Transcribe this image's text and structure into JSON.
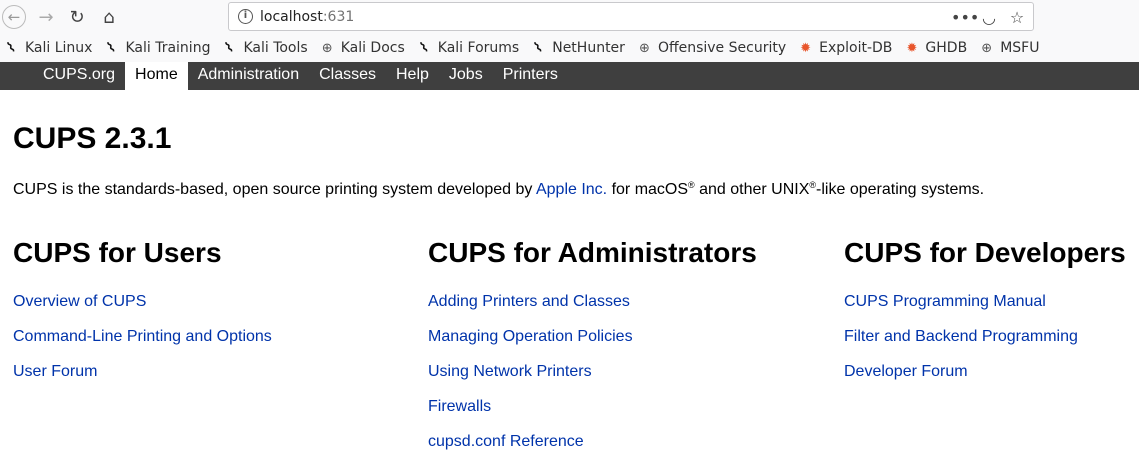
{
  "browser": {
    "url_host": "localhost",
    "url_port": ":631",
    "bookmarks": [
      {
        "label": "Kali Linux",
        "icon": "kali-dragon-icon"
      },
      {
        "label": "Kali Training",
        "icon": "kali-dragon-icon"
      },
      {
        "label": "Kali Tools",
        "icon": "kali-dragon-icon"
      },
      {
        "label": "Kali Docs",
        "icon": "globe-icon"
      },
      {
        "label": "Kali Forums",
        "icon": "kali-dragon-icon"
      },
      {
        "label": "NetHunter",
        "icon": "kali-dragon-icon"
      },
      {
        "label": "Offensive Security",
        "icon": "globe-icon"
      },
      {
        "label": "Exploit-DB",
        "icon": "exploitdb-icon"
      },
      {
        "label": "GHDB",
        "icon": "exploitdb-icon"
      },
      {
        "label": "MSFU",
        "icon": "globe-icon"
      }
    ]
  },
  "nav": {
    "items": [
      {
        "label": "CUPS.org"
      },
      {
        "label": "Home"
      },
      {
        "label": "Administration"
      },
      {
        "label": "Classes"
      },
      {
        "label": "Help"
      },
      {
        "label": "Jobs"
      },
      {
        "label": "Printers"
      }
    ]
  },
  "main": {
    "title": "CUPS 2.3.1",
    "intro": {
      "text1": "CUPS is the standards-based, open source printing system developed by ",
      "link": "Apple Inc.",
      "text2": " for macOS",
      "reg1": "®",
      "text3": " and other UNIX",
      "reg2": "®",
      "text4": "-like operating systems."
    },
    "columns": [
      {
        "heading": "CUPS for Users",
        "links": [
          "Overview of CUPS",
          "Command-Line Printing and Options",
          "User Forum"
        ]
      },
      {
        "heading": "CUPS for Administrators",
        "links": [
          "Adding Printers and Classes",
          "Managing Operation Policies",
          "Using Network Printers",
          "Firewalls",
          "cupsd.conf Reference"
        ]
      },
      {
        "heading": "CUPS for Developers",
        "links": [
          "CUPS Programming Manual",
          "Filter and Backend Programming",
          "Developer Forum"
        ]
      }
    ]
  },
  "colors": {
    "header_bg": "#3f3f3f",
    "link": "#0033aa"
  }
}
